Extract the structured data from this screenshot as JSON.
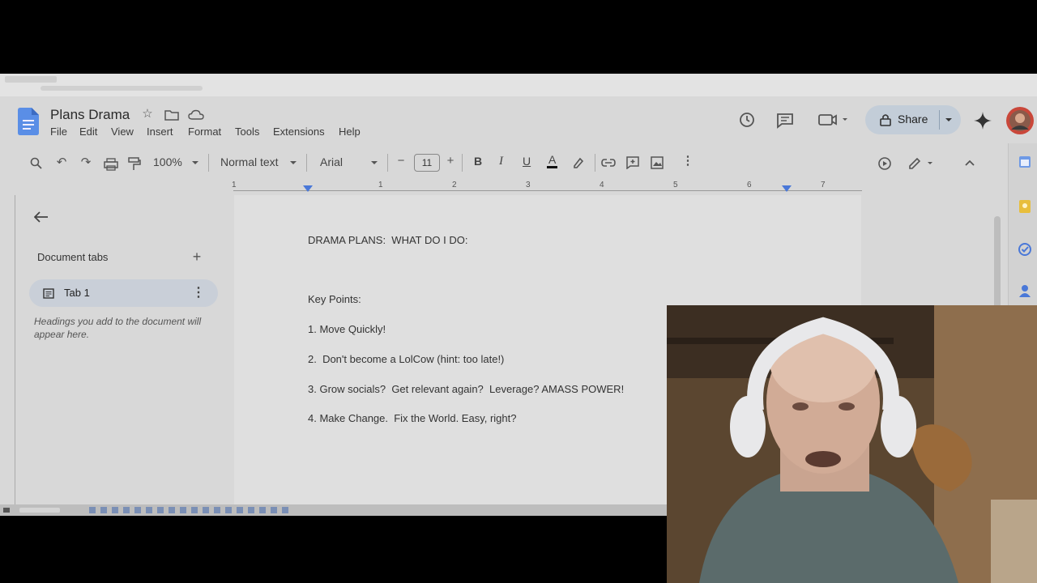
{
  "document": {
    "title": "Plans Drama",
    "menus": [
      "File",
      "Edit",
      "View",
      "Insert",
      "Format",
      "Tools",
      "Extensions",
      "Help"
    ],
    "share_label": "Share"
  },
  "toolbar": {
    "zoom": "100%",
    "style": "Normal text",
    "font": "Arial",
    "font_size": "11"
  },
  "ruler": {
    "ticks": [
      "1",
      "1",
      "2",
      "3",
      "4",
      "5",
      "6",
      "7"
    ]
  },
  "sidebar": {
    "section_title": "Document tabs",
    "tab_label": "Tab 1",
    "hint": "Headings you add to the document will appear here."
  },
  "content": {
    "heading": "DRAMA PLANS:  WHAT DO I DO:",
    "subheading": "Key Points:",
    "items": [
      "1. Move Quickly!",
      "2.  Don't become a LolCow (hint: too late!)",
      "3. Grow socials?  Get relevant again?  Leverage? AMASS POWER!",
      "4. Make Change.  Fix the World. Easy, right?"
    ]
  }
}
